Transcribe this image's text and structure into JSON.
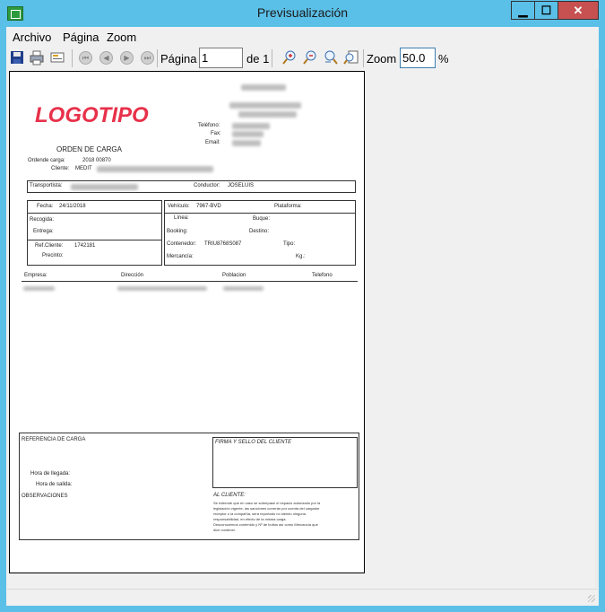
{
  "window": {
    "title": "Previsualización",
    "min_label": "▁",
    "max_label": "☐",
    "close_label": "✕"
  },
  "menu": {
    "items": [
      "Archivo",
      "Página",
      "Zoom"
    ]
  },
  "toolbar": {
    "page_label": "Página",
    "page_value": "1",
    "page_of": "de 1",
    "zoom_label": "Zoom",
    "zoom_value": "50.0",
    "zoom_unit": "%",
    "icons": [
      "save-icon",
      "print-icon",
      "export-icon",
      "first-page-icon",
      "prev-page-icon",
      "next-page-icon",
      "last-page-icon",
      "zoom-in-icon",
      "zoom-out-icon",
      "zoom-width-icon",
      "zoom-page-icon"
    ]
  },
  "document": {
    "logo": "LOGOTIPO",
    "telefono": "Teléfono:",
    "fax": "Fax:",
    "email": "Email:",
    "title": "ORDEN DE CARGA",
    "orden_label": "Ordende carga:",
    "orden_value": "2018 00870",
    "cliente_label": "Cliente:",
    "cliente_value": "MEDIT",
    "transportista_label": "Transportista:",
    "conductor_label": "Conductor:",
    "conductor_value": "JOSELUIS",
    "fecha_label": "Fecha:",
    "fecha_value": "24/11/2018",
    "recogida": "Recogida:",
    "entrega": "Entrega:",
    "refcliente_label": "Ref.Cliente:",
    "refcliente_value": "1742181",
    "precinto": "Precinto:",
    "vehiculo_label": "Vehículo:",
    "vehiculo_value": "7967-BVD",
    "plataforma": "Plataforma:",
    "linea": "Línea:",
    "buque": "Buque:",
    "booking": "Booking:",
    "destino": "Destino:",
    "contenedor_label": "Contenedor:",
    "contenedor_value": "TRIU8768S087",
    "tipo": "Tipo:",
    "mercancia": "Mercancía:",
    "kg": "Kg.:",
    "col_empresa": "Empresa:",
    "col_direccion": "Dirección",
    "col_poblacion": "Poblacion",
    "col_telefono": "Telefono",
    "referencia": "REFERENCIA DE CARGA",
    "hora_llegada": "Hora de llegada:",
    "hora_salida": "Hora de salida:",
    "observaciones": "OBSERVACIONES",
    "firma": "FIRMA Y SELLO DEL CLIENTE",
    "al_cliente": "AL CLIENTE:",
    "legal_1": "Se extiende que en caso se sobrepase el espacio autorizado por la",
    "legal_2": "legislación vigente, las sanciones correrán por cuenta del cargador",
    "legal_3": "receptor o la compañía, será reportado no siendo ninguna",
    "legal_4": "responsabilidad, en efecto de la misma carga.",
    "legal_5": "Desconocemos contenido y Nº de bultos así como Mercancía que",
    "legal_6": "dice contener."
  }
}
